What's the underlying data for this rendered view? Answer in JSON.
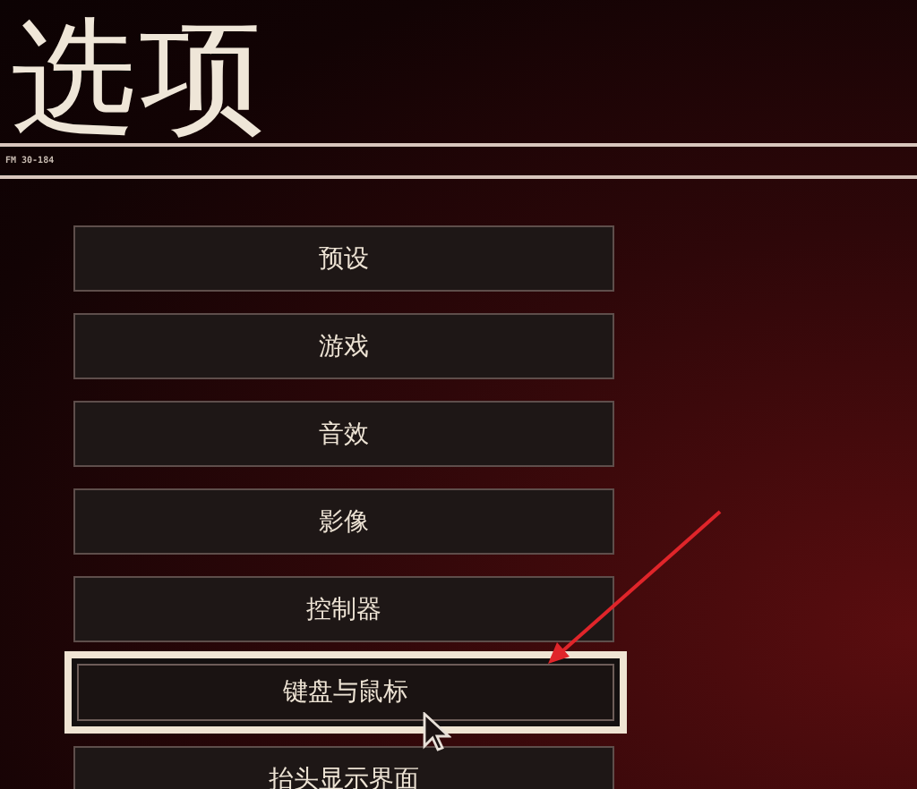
{
  "title": "选项",
  "subtitle": "FM 30-184",
  "menu": [
    {
      "label": "预设",
      "selected": false
    },
    {
      "label": "游戏",
      "selected": false
    },
    {
      "label": "音效",
      "selected": false
    },
    {
      "label": "影像",
      "selected": false
    },
    {
      "label": "控制器",
      "selected": false
    },
    {
      "label": "键盘与鼠标",
      "selected": true
    },
    {
      "label": "抬头显示界面",
      "selected": false
    }
  ]
}
